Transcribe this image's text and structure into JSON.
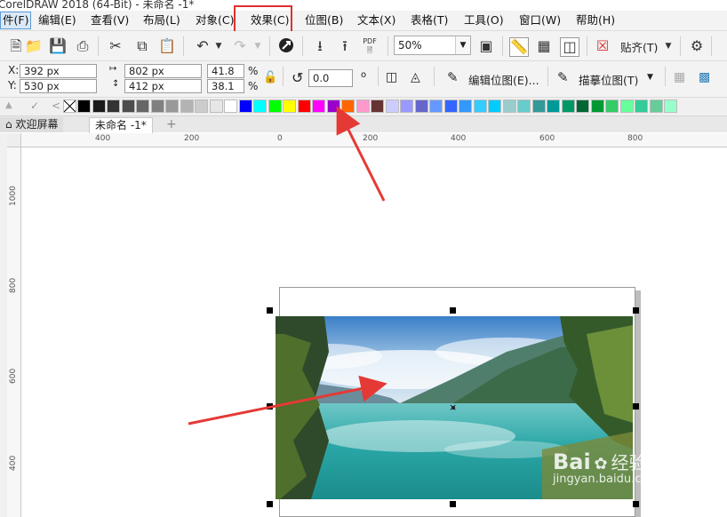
{
  "window": {
    "title": "CorelDRAW 2018 (64-Bit) - 未命名 -1*"
  },
  "menu": [
    {
      "id": "file",
      "label": "件(F)"
    },
    {
      "id": "edit",
      "label": "编辑(E)"
    },
    {
      "id": "view",
      "label": "查看(V)"
    },
    {
      "id": "layout",
      "label": "布局(L)"
    },
    {
      "id": "object",
      "label": "对象(C)"
    },
    {
      "id": "effects",
      "label": "效果(C)"
    },
    {
      "id": "bitmaps",
      "label": "位图(B)"
    },
    {
      "id": "text",
      "label": "文本(X)"
    },
    {
      "id": "table",
      "label": "表格(T)"
    },
    {
      "id": "tools",
      "label": "工具(O)"
    },
    {
      "id": "window",
      "label": "窗口(W)"
    },
    {
      "id": "help",
      "label": "帮助(H)"
    }
  ],
  "toolbar": {
    "zoom_value": "50%",
    "pdf_label": "PDF",
    "snap_label": "贴齐(T)"
  },
  "properties": {
    "x_label": "X:",
    "y_label": "Y:",
    "x_value": "392 px",
    "y_value": "530 px",
    "width_value": "802 px",
    "height_value": "412 px",
    "scale_x": "41.8",
    "scale_y": "38.1",
    "percent": "%",
    "rotation": "0.0",
    "degree_symbol": "o",
    "edit_bitmap_label": "编辑位图(E)...",
    "trace_bitmap_label": "描摹位图(T)"
  },
  "palette": {
    "colors": [
      "#000000",
      "#1a1a1a",
      "#333333",
      "#4d4d4d",
      "#666666",
      "#808080",
      "#999999",
      "#b3b3b3",
      "#cccccc",
      "#e6e6e6",
      "#ffffff",
      "#0000ff",
      "#00ffff",
      "#00ff00",
      "#ffff00",
      "#ff0000",
      "#ff00ff",
      "#9900cc",
      "#ff6600",
      "#ff99cc",
      "#663333",
      "#ccccff",
      "#9999ff",
      "#6666cc",
      "#6699ff",
      "#3366ff",
      "#3399ff",
      "#33ccff",
      "#00ccff",
      "#99cccc",
      "#66cccc",
      "#339999",
      "#009999",
      "#009966",
      "#006633",
      "#009933",
      "#33cc66",
      "#66ff99",
      "#33cc99",
      "#66cc99",
      "#99ffcc"
    ]
  },
  "tabs": [
    {
      "label": "欢迎屏幕"
    },
    {
      "label": "未命名 -1*"
    },
    {
      "label": "+"
    }
  ],
  "ruler": {
    "h_ticks": [
      "400",
      "200",
      "0",
      "200",
      "400",
      "600",
      "800"
    ],
    "v_ticks": [
      "1000",
      "800",
      "600",
      "400"
    ]
  },
  "watermark": {
    "brand": "Bai",
    "brand_cn": "经验",
    "url": "jingyan.baidu.com"
  },
  "annotation_color": "#e53935"
}
